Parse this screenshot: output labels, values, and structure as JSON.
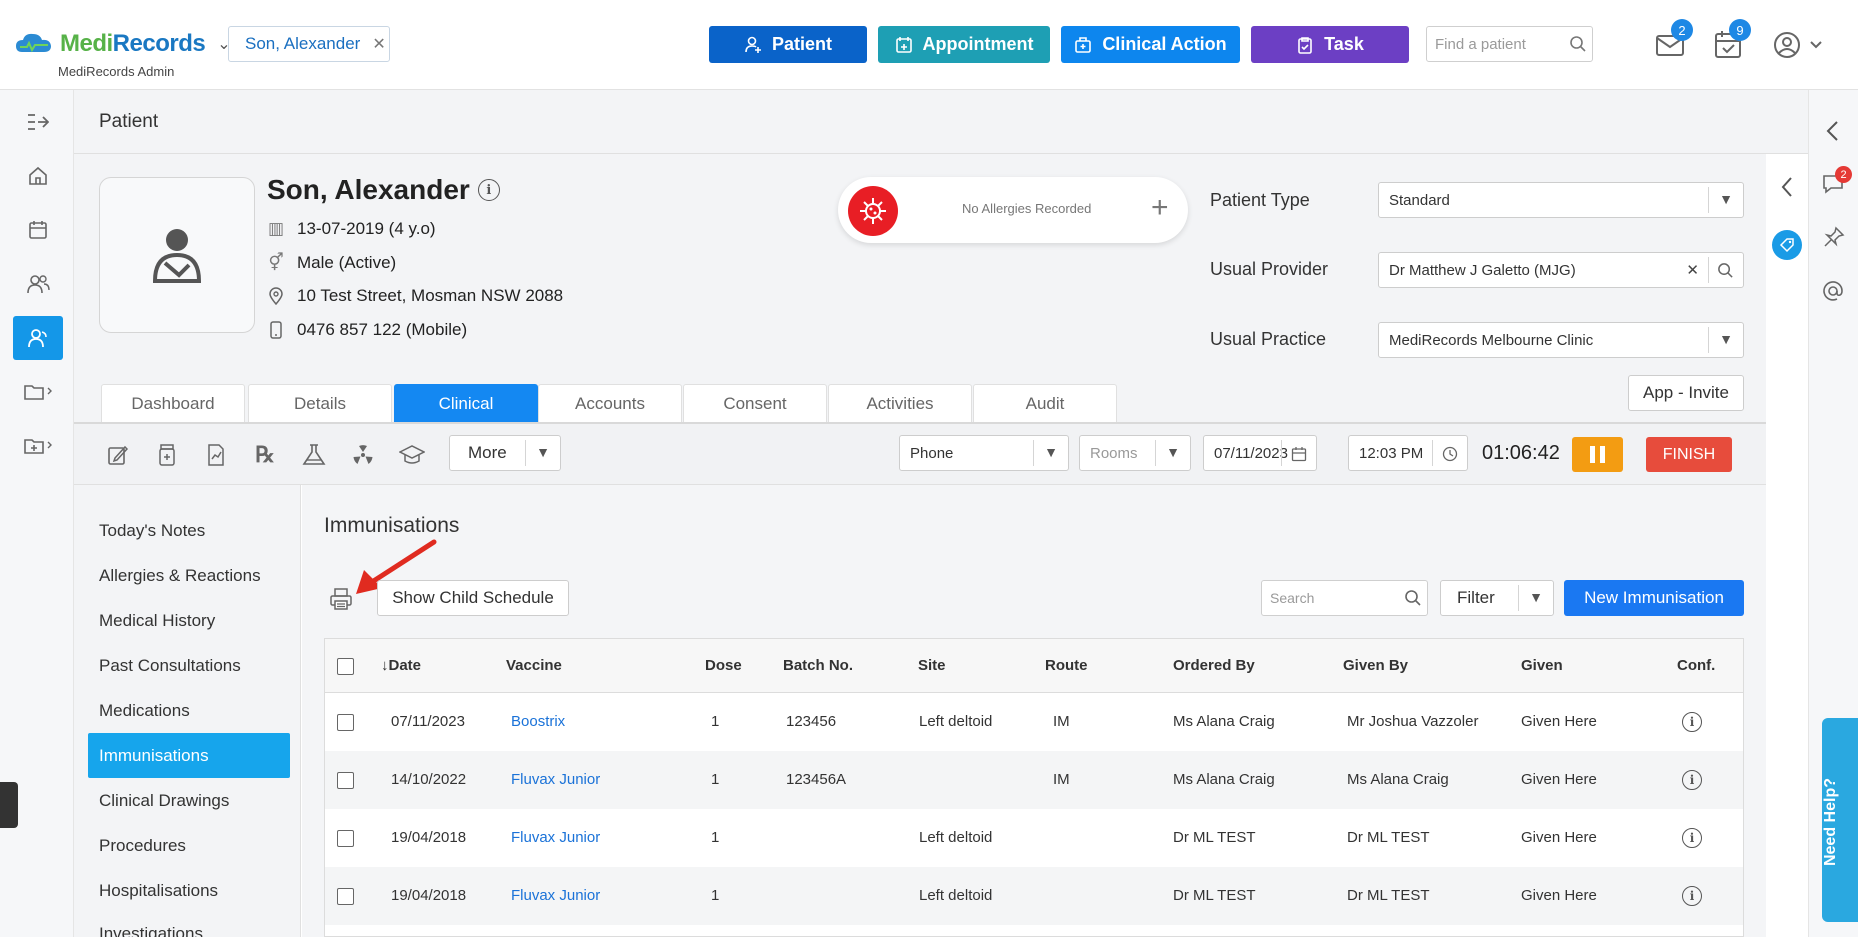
{
  "app": {
    "logo_text_1": "Medi",
    "logo_text_2": "Records",
    "admin_label": "MediRecords Admin",
    "patient_chip": "Son, Alexander",
    "buttons": {
      "patient": "Patient",
      "appointment": "Appointment",
      "clinical_action": "Clinical Action",
      "task": "Task"
    },
    "search_placeholder": "Find a patient",
    "mail_count": "2",
    "calendar_count": "9",
    "colors": {
      "patient": "#0a63c9",
      "appointment": "#1e9fb4",
      "clinical_action": "#0d86ee",
      "task": "#6c3fc4"
    }
  },
  "page": {
    "title": "Patient"
  },
  "patient": {
    "name": "Son, Alexander",
    "dob": "13-07-2019 (4 y.o)",
    "gender": "Male (Active)",
    "address": "10 Test Street, Mosman NSW 2088",
    "phone": "0476 857 122 (Mobile)",
    "allergy_text": "No Allergies Recorded",
    "patient_type_label": "Patient Type",
    "patient_type": "Standard",
    "usual_provider_label": "Usual Provider",
    "usual_provider": "Dr Matthew J Galetto (MJG)",
    "usual_practice_label": "Usual Practice",
    "usual_practice": "MediRecords Melbourne Clinic",
    "invite_label": "App - Invite"
  },
  "tabs": [
    "Dashboard",
    "Details",
    "Clinical",
    "Accounts",
    "Consent",
    "Activities",
    "Audit"
  ],
  "toolbar": {
    "more_label": "More",
    "mode": "Phone",
    "rooms_placeholder": "Rooms",
    "date": "07/11/2023",
    "time": "12:03 PM",
    "timer": "01:06:42",
    "finish_label": "FINISH"
  },
  "clinical_nav": [
    "Today's Notes",
    "Allergies & Reactions",
    "Medical History",
    "Past Consultations",
    "Medications",
    "Immunisations",
    "Clinical Drawings",
    "Procedures",
    "Hospitalisations",
    "Investigations"
  ],
  "immunisations": {
    "title": "Immunisations",
    "child_schedule_label": "Show Child Schedule",
    "search_placeholder": "Search",
    "filter_label": "Filter",
    "new_label": "New Immunisation",
    "columns": [
      "↓Date",
      "Vaccine",
      "Dose",
      "Batch No.",
      "Site",
      "Route",
      "Ordered By",
      "Given By",
      "Given",
      "Conf."
    ],
    "rows": [
      {
        "date": "07/11/2023",
        "vaccine": "Boostrix",
        "dose": "1",
        "batch": "123456",
        "site": "Left deltoid",
        "route": "IM",
        "ordered_by": "Ms Alana Craig",
        "given_by": "Mr Joshua Vazzoler",
        "given": "Given Here"
      },
      {
        "date": "14/10/2022",
        "vaccine": "Fluvax Junior",
        "dose": "1",
        "batch": "123456A",
        "site": "",
        "route": "IM",
        "ordered_by": "Ms Alana Craig",
        "given_by": "Ms Alana Craig",
        "given": "Given Here"
      },
      {
        "date": "19/04/2018",
        "vaccine": "Fluvax Junior",
        "dose": "1",
        "batch": "",
        "site": "Left deltoid",
        "route": "",
        "ordered_by": "Dr ML TEST",
        "given_by": "Dr ML TEST",
        "given": "Given Here"
      },
      {
        "date": "19/04/2018",
        "vaccine": "Fluvax Junior",
        "dose": "1",
        "batch": "",
        "site": "Left deltoid",
        "route": "",
        "ordered_by": "Dr ML TEST",
        "given_by": "Dr ML TEST",
        "given": "Given Here"
      }
    ]
  },
  "notifications_count": "2",
  "need_help_label": "Need Help?"
}
